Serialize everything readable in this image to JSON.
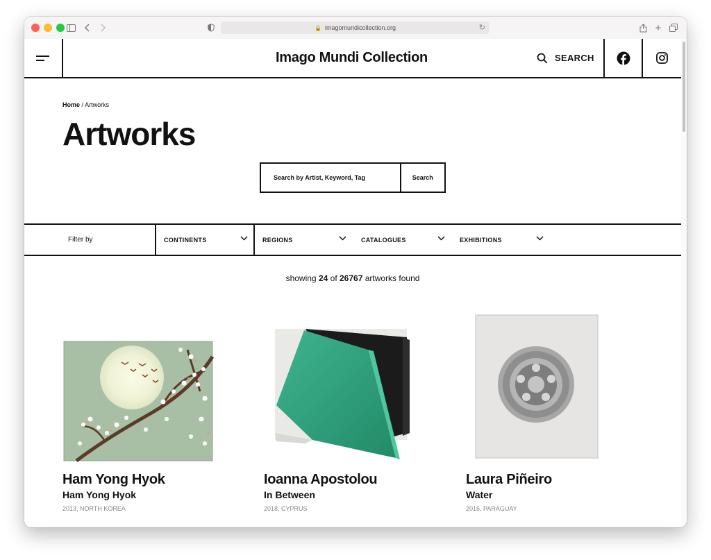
{
  "browser": {
    "url": "imagomundicollection.org"
  },
  "header": {
    "site_title": "Imago Mundi Collection",
    "search_label": "SEARCH"
  },
  "breadcrumb": {
    "home": "Home",
    "separator": "/",
    "current": "Artworks"
  },
  "page_title": "Artworks",
  "search": {
    "placeholder": "Search by Artist, Keyword, Tag",
    "button_label": "Search"
  },
  "filters": {
    "label": "Filter by",
    "items": [
      {
        "label": "CONTINENTS"
      },
      {
        "label": "REGIONS"
      },
      {
        "label": "CATALOGUES"
      },
      {
        "label": "EXHIBITIONS"
      }
    ]
  },
  "results": {
    "prefix": "showing",
    "shown": "24",
    "middle": "of",
    "total": "26767",
    "suffix": "artworks found"
  },
  "artworks": [
    {
      "artist": "Ham Yong Hyok",
      "title": "Ham Yong Hyok",
      "meta": "2013, NORTH KOREA",
      "image_icon": "blossom-painting"
    },
    {
      "artist": "Ioanna Apostolou",
      "title": "In Between",
      "meta": "2018, CYPRUS",
      "image_icon": "green-geometric-painting"
    },
    {
      "artist": "Laura Piñeiro",
      "title": "Water",
      "meta": "2016, PARAGUAY",
      "image_icon": "drain-painting"
    }
  ],
  "colors": {
    "text": "#111111",
    "meta_text": "#888888",
    "artwork_green": "#2fa37f",
    "blossom_bg": "#a8bfa5"
  }
}
